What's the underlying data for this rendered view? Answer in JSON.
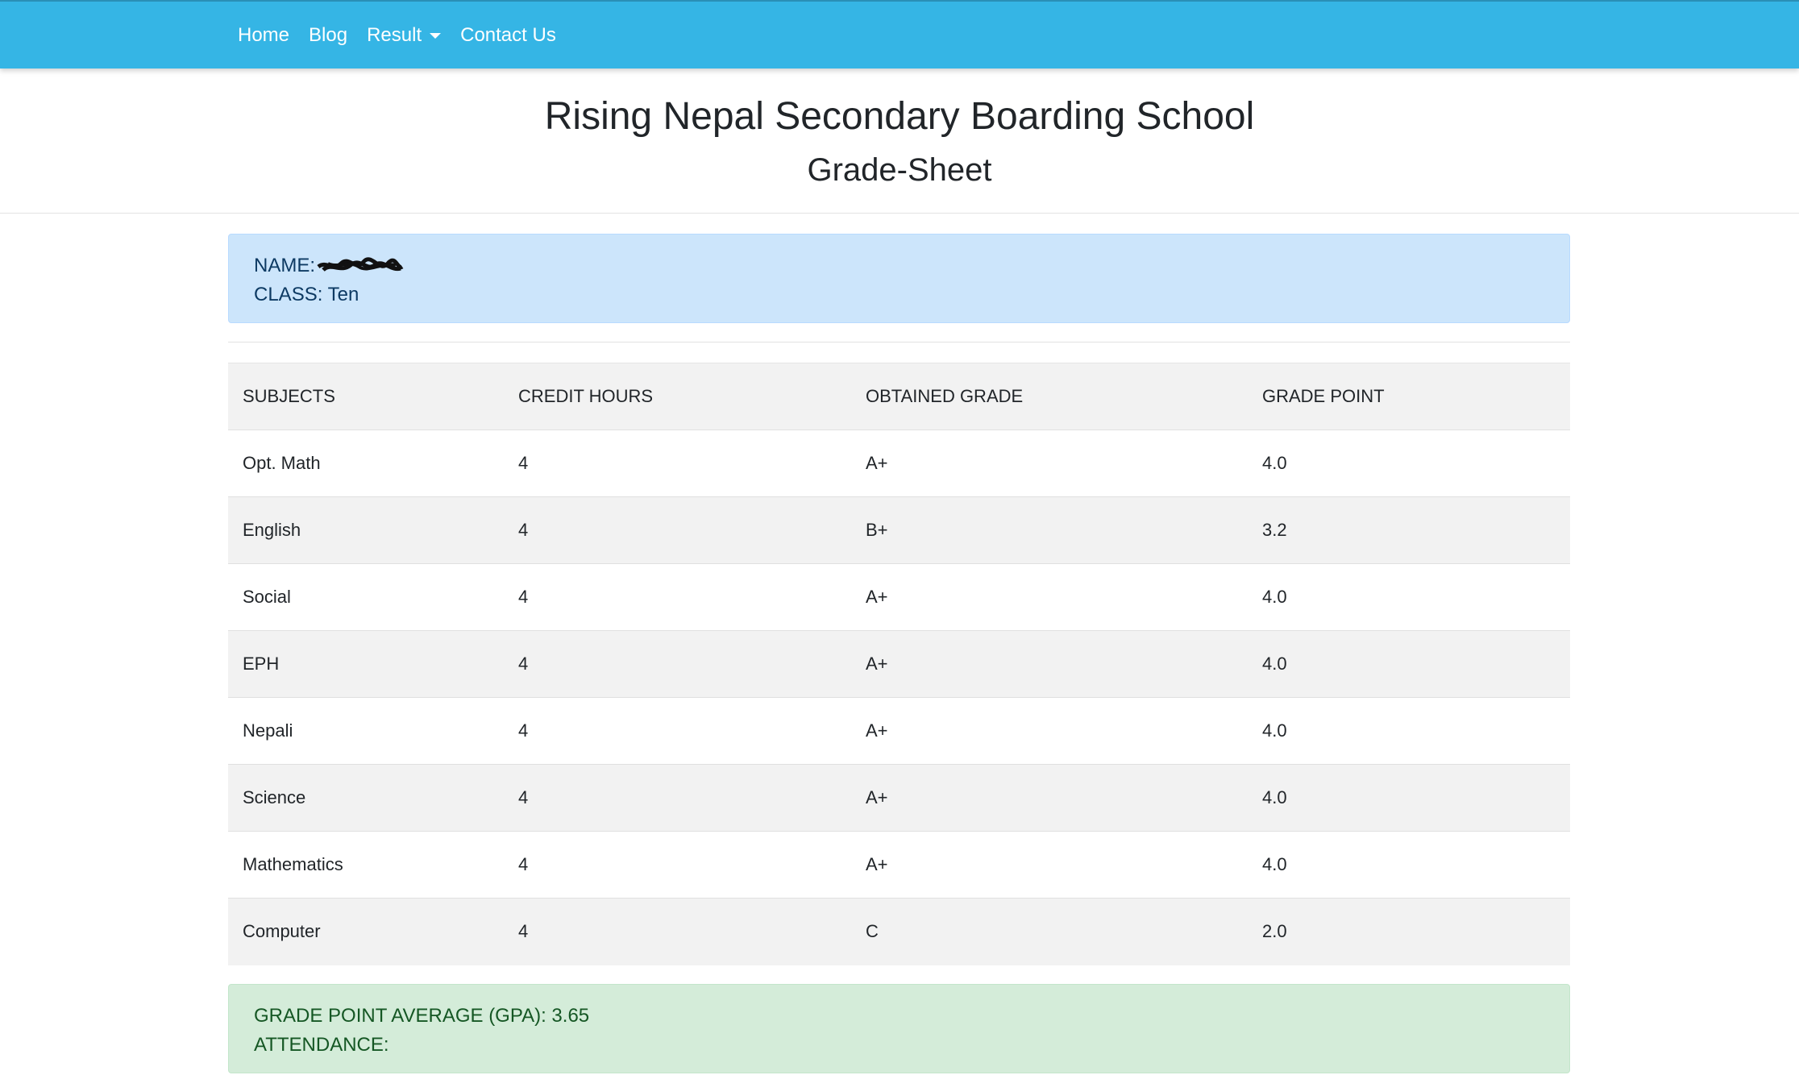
{
  "nav": {
    "items": [
      {
        "label": "Home"
      },
      {
        "label": "Blog"
      },
      {
        "label": "Result",
        "dropdown": true
      },
      {
        "label": "Contact Us"
      }
    ]
  },
  "header": {
    "school_name": "Rising Nepal Secondary Boarding School",
    "sheet_title": "Grade-Sheet"
  },
  "student": {
    "name_label": "NAME:",
    "class_label": "CLASS:",
    "class_value": "Ten"
  },
  "table": {
    "headers": [
      "SUBJECTS",
      "CREDIT HOURS",
      "OBTAINED GRADE",
      "GRADE POINT"
    ],
    "rows": [
      [
        "Opt. Math",
        "4",
        "A+",
        "4.0"
      ],
      [
        "English",
        "4",
        "B+",
        "3.2"
      ],
      [
        "Social",
        "4",
        "A+",
        "4.0"
      ],
      [
        "EPH",
        "4",
        "A+",
        "4.0"
      ],
      [
        "Nepali",
        "4",
        "A+",
        "4.0"
      ],
      [
        "Science",
        "4",
        "A+",
        "4.0"
      ],
      [
        "Mathematics",
        "4",
        "A+",
        "4.0"
      ],
      [
        "Computer",
        "4",
        "C",
        "2.0"
      ]
    ]
  },
  "summary": {
    "gpa_label": "GRADE POINT AVERAGE (GPA):",
    "gpa_value": "3.65",
    "attendance_label": "ATTENDANCE:"
  },
  "colors": {
    "navbar": "#35b5e5",
    "info_box": "#cce5fb",
    "gpa_box": "#d4ecd9"
  }
}
